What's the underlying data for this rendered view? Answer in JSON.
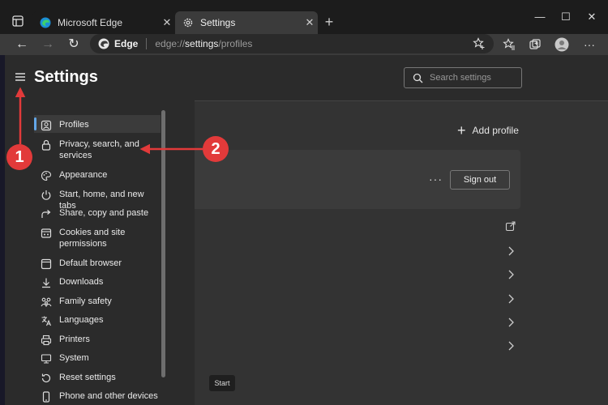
{
  "browser": {
    "tabs": [
      {
        "label": "Microsoft Edge",
        "icon": "edge-logo-icon"
      },
      {
        "label": "Settings",
        "icon": "gear-icon"
      }
    ],
    "new_tab": "+",
    "window_controls": {
      "minimize": "—",
      "maximize": "☐",
      "close": "✕"
    },
    "address": {
      "site": "Edge",
      "url_prefix": "edge://",
      "url_bold": "settings",
      "url_suffix": "/profiles"
    }
  },
  "settings": {
    "title": "Settings",
    "search_placeholder": "Search settings",
    "nav": [
      {
        "label": "Profiles",
        "icon": "profile-icon",
        "active": true
      },
      {
        "label": "Privacy, search, and services",
        "icon": "lock-icon"
      },
      {
        "label": "Appearance",
        "icon": "palette-icon"
      },
      {
        "label": "Start, home, and new tabs",
        "icon": "power-icon"
      },
      {
        "label": "Share, copy and paste",
        "icon": "share-icon"
      },
      {
        "label": "Cookies and site permissions",
        "icon": "cookie-icon"
      },
      {
        "label": "Default browser",
        "icon": "browser-icon"
      },
      {
        "label": "Downloads",
        "icon": "download-icon"
      },
      {
        "label": "Family safety",
        "icon": "family-icon"
      },
      {
        "label": "Languages",
        "icon": "languages-icon"
      },
      {
        "label": "Printers",
        "icon": "printer-icon"
      },
      {
        "label": "System",
        "icon": "system-icon"
      },
      {
        "label": "Reset settings",
        "icon": "reset-icon"
      },
      {
        "label": "Phone and other devices",
        "icon": "phone-icon"
      }
    ],
    "add_profile": "Add profile",
    "more": "···",
    "sign_out": "Sign out"
  },
  "tooltip": "Start",
  "annotations": {
    "badge1": "1",
    "badge2": "2"
  },
  "colors": {
    "accent": "#63a7e8",
    "annotation": "#e23a3a"
  }
}
